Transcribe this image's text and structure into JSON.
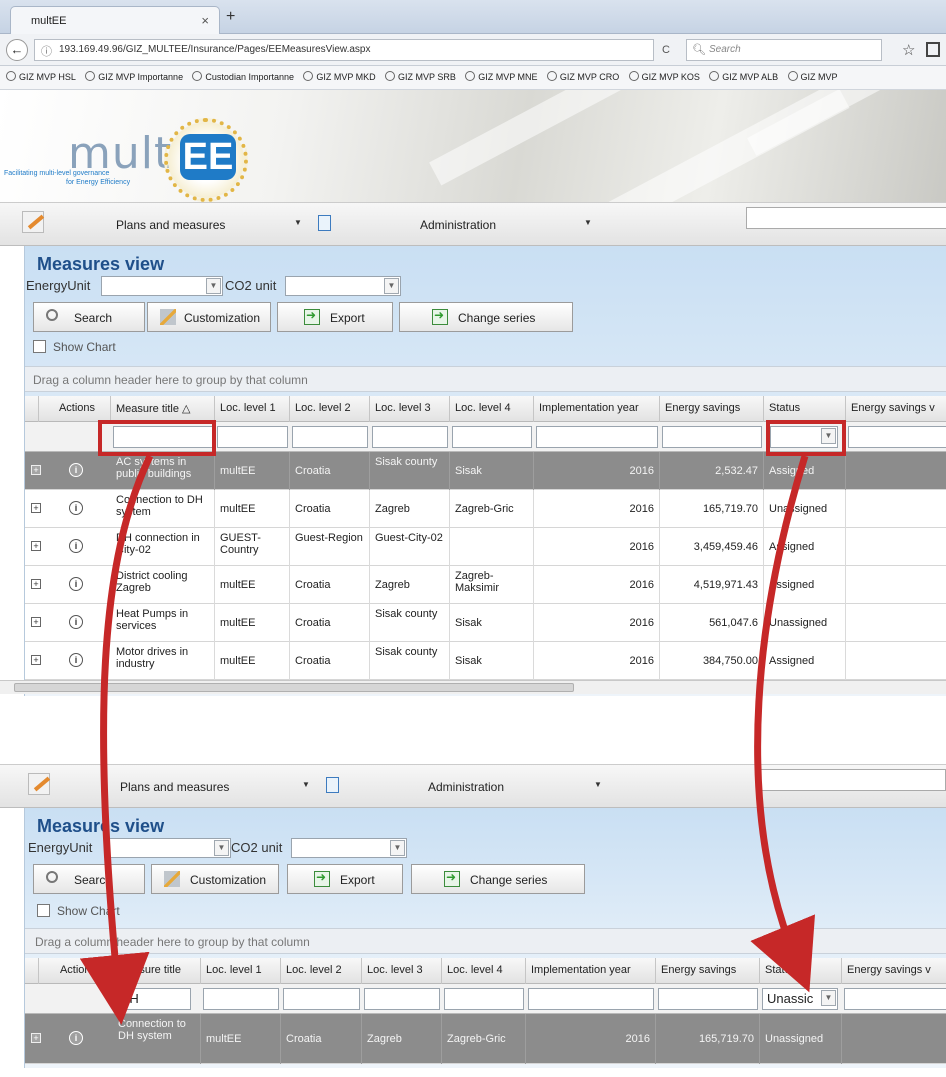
{
  "browser": {
    "tab_title": "multEE",
    "tab_close": "×",
    "new_tab": "+",
    "url": "193.169.49.96/GIZ_MULTEE/Insurance/Pages/EEMeasuresView.aspx",
    "search_placeholder": "Search",
    "bookmarks": [
      "GIZ MVP HSL",
      "GIZ MVP Importanne",
      "Custodian Importanne",
      "GIZ MVP MKD",
      "GIZ MVP SRB",
      "GIZ MVP MNE",
      "GIZ MVP CRO",
      "GIZ MVP KOS",
      "GIZ MVP ALB",
      "GIZ MVP"
    ]
  },
  "logo": {
    "word": "mult",
    "ee": "EE",
    "tagline1": "Facilitating multi-level governance",
    "tagline2": "for Energy Efficiency"
  },
  "menu": {
    "plans": "Plans and measures",
    "admin": "Administration"
  },
  "measures": {
    "title": "Measures view",
    "energy_unit_label": "EnergyUnit",
    "co2_unit_label": "CO2 unit",
    "buttons": {
      "search": "Search",
      "customization": "Customization",
      "export": "Export",
      "change_series": "Change series"
    },
    "show_chart": "Show Chart",
    "group_hint": "Drag a column header here to group by that column",
    "columns_top": [
      "Actions",
      "Measure title △",
      "Loc. level 1",
      "Loc. level 2",
      "Loc. level 3",
      "Loc. level 4",
      "Implementation year",
      "Energy savings",
      "Status",
      "Energy savings v"
    ],
    "columns_bottom": [
      "Actions",
      "Measure title",
      "Loc. level 1",
      "Loc. level 2",
      "Loc. level 3",
      "Loc. level 4",
      "Implementation year",
      "Energy savings",
      "Status",
      "Energy savings v"
    ],
    "rows_top": [
      {
        "title": "AC systems in public buildings",
        "l1": "multEE",
        "l2": "Croatia",
        "l3": "Sisak county",
        "l4": "Sisak",
        "year": "2016",
        "savings": "2,532.47",
        "status": "Assigned"
      },
      {
        "title": "Connection to DH system",
        "l1": "multEE",
        "l2": "Croatia",
        "l3": "Zagreb",
        "l4": "Zagreb-Gric",
        "year": "2016",
        "savings": "165,719.70",
        "status": "Unassigned"
      },
      {
        "title": "DH connection in City-02",
        "l1": "GUEST-Country",
        "l2": "Guest-Region",
        "l3": "Guest-City-02",
        "l4": "",
        "year": "2016",
        "savings": "3,459,459.46",
        "status": "Assigned"
      },
      {
        "title": "District cooling Zagreb",
        "l1": "multEE",
        "l2": "Croatia",
        "l3": "Zagreb",
        "l4": "Zagreb-Maksimir",
        "year": "2016",
        "savings": "4,519,971.43",
        "status": "Assigned"
      },
      {
        "title": "Heat Pumps in services",
        "l1": "multEE",
        "l2": "Croatia",
        "l3": "Sisak county",
        "l4": "Sisak",
        "year": "2016",
        "savings": "561,047.6",
        "status": "Unassigned"
      },
      {
        "title": "Motor drives in industry",
        "l1": "multEE",
        "l2": "Croatia",
        "l3": "Sisak county",
        "l4": "Sisak",
        "year": "2016",
        "savings": "384,750.00",
        "status": "Assigned"
      }
    ],
    "filter_bottom": {
      "title": "DH",
      "status": "Unassic"
    },
    "rows_bottom": [
      {
        "title": "Connection to DH system",
        "l1": "multEE",
        "l2": "Croatia",
        "l3": "Zagreb",
        "l4": "Zagreb-Gric",
        "year": "2016",
        "savings": "165,719.70",
        "status": "Unassigned"
      }
    ]
  },
  "colors": {
    "accent": "#1f4f8a",
    "arrow": "#c62828",
    "selected_row": "#8c8c8c"
  }
}
